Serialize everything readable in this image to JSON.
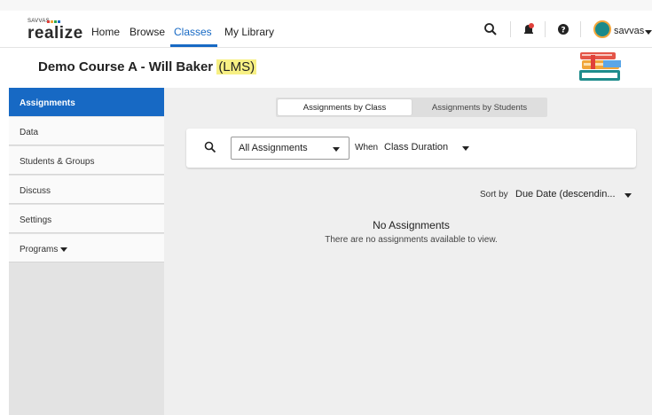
{
  "nav": {
    "logo_small": "SAVVAS",
    "logo_big": "realize",
    "links": [
      "Home",
      "Browse",
      "Classes",
      "My Library"
    ],
    "active_link": "Classes",
    "user": "savvas"
  },
  "course": {
    "title": "Demo Course A - Will Baker",
    "tag": "(LMS)"
  },
  "sidebar": {
    "items": [
      {
        "label": "Assignments"
      },
      {
        "label": "Data"
      },
      {
        "label": "Students & Groups"
      },
      {
        "label": "Discuss"
      },
      {
        "label": "Settings"
      },
      {
        "label": "Programs"
      }
    ]
  },
  "tabs": {
    "by_class": "Assignments by Class",
    "by_students": "Assignments by Students"
  },
  "filters": {
    "assignment_select": "All Assignments",
    "when_label": "When",
    "when_select": "Class Duration"
  },
  "sort": {
    "label": "Sort by",
    "value": "Due Date (descendin..."
  },
  "empty": {
    "title": "No Assignments",
    "text": "There are no assignments available to view."
  },
  "colors": {
    "accent": "#1769c4",
    "highlight": "#f7f084",
    "sidebar_bg": "#e3e3e3",
    "main_bg": "#efefef"
  },
  "icons": [
    "search-icon",
    "notification-icon",
    "help-icon",
    "books-icon",
    "chevron-down-icon"
  ]
}
